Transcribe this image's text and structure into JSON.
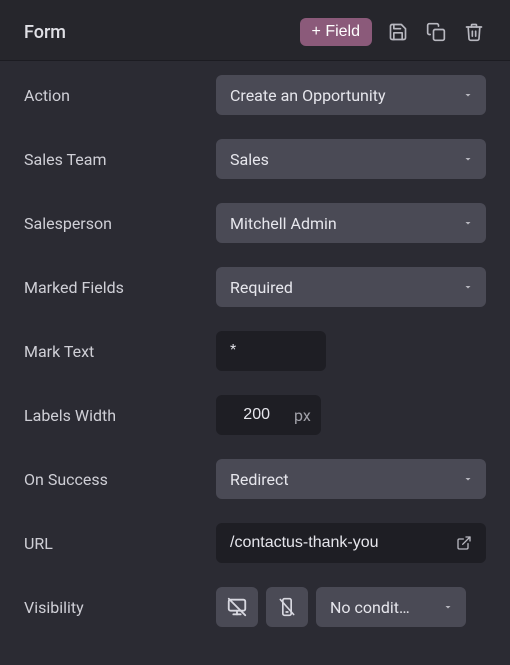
{
  "header": {
    "title": "Form",
    "add_field_label": "+ Field"
  },
  "fields": {
    "action": {
      "label": "Action",
      "value": "Create an Opportunity"
    },
    "sales_team": {
      "label": "Sales Team",
      "value": "Sales"
    },
    "salesperson": {
      "label": "Salesperson",
      "value": "Mitchell Admin"
    },
    "marked_fields": {
      "label": "Marked Fields",
      "value": "Required"
    },
    "mark_text": {
      "label": "Mark Text",
      "value": "*"
    },
    "labels_width": {
      "label": "Labels Width",
      "value": "200",
      "unit": "px"
    },
    "on_success": {
      "label": "On Success",
      "value": "Redirect"
    },
    "url": {
      "label": "URL",
      "value": "/contactus-thank-you"
    },
    "visibility": {
      "label": "Visibility",
      "condition_value": "No condit…"
    }
  }
}
